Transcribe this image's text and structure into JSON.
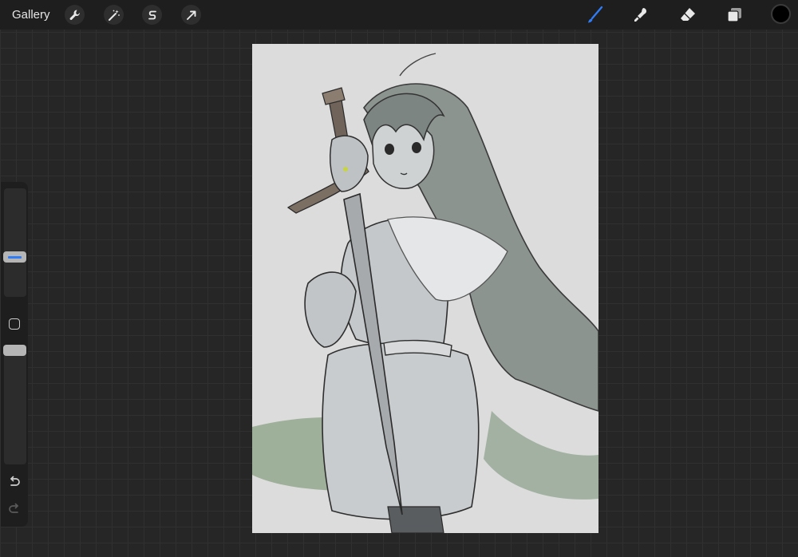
{
  "topbar": {
    "gallery_label": "Gallery",
    "left_tools": [
      "wrench-icon",
      "magic-wand-icon",
      "selection-s-icon",
      "transform-arrow-icon"
    ],
    "right_tools": [
      "brush-icon",
      "smudge-icon",
      "eraser-icon",
      "layers-icon"
    ],
    "active_tool": "brush-icon",
    "current_color": "#000000",
    "accent_color": "#2f7cf6"
  },
  "sidebar": {
    "brush_size": 0.35,
    "opacity": 1.0,
    "icons": [
      "modify-square-icon",
      "undo-icon",
      "redo-icon"
    ]
  },
  "canvas": {
    "background_color": "#dcdcdc"
  }
}
